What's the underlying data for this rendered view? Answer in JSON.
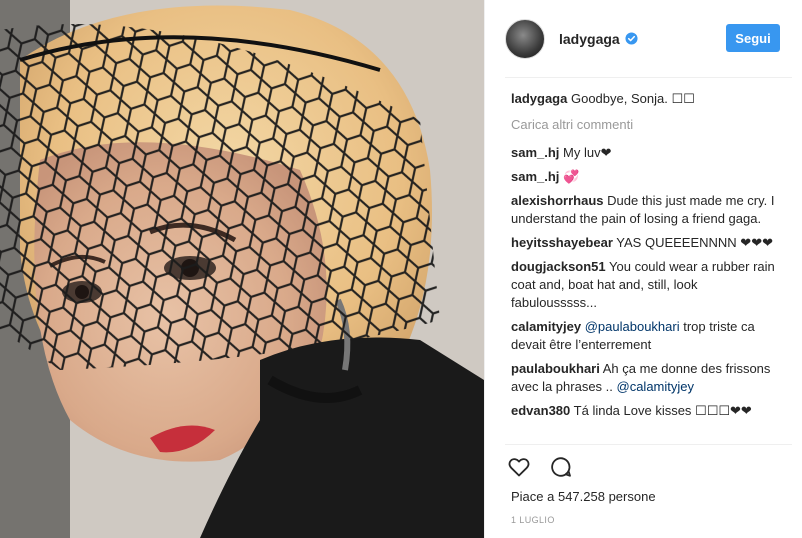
{
  "post": {
    "author": "ladygaga",
    "follow_label": "Segui",
    "caption_user": "ladygaga",
    "caption_text": "Goodbye, Sonja. ☐☐",
    "load_more": "Carica altri commenti",
    "comments": [
      {
        "user": "sam_.hj",
        "text": "My luv❤"
      },
      {
        "user": "sam_.hj",
        "text": "💞"
      },
      {
        "user": "alexishorrhaus",
        "text": "Dude this just made me cry. I understand the pain of losing a friend gaga."
      },
      {
        "user": "heyitsshayebear",
        "text": "YAS QUEEEENNNN ❤❤❤"
      },
      {
        "user": "dougjackson51",
        "text": "You could wear a rubber rain coat and, boat hat and, still, look fabulousssss..."
      },
      {
        "user": "calamityjey",
        "mention": "@paulaboukhari",
        "text": " trop triste ca devait être l’enterrement"
      },
      {
        "user": "paulaboukhari",
        "text": "Ah ça me donne des frissons avec la phrases .. ",
        "mention": "@calamityjey"
      },
      {
        "user": "edvan380",
        "text": "Tá linda Love kisses ☐☐☐❤❤"
      }
    ],
    "likes": "Piace a 547.258 persone",
    "date": "1 LUGLIO"
  },
  "icons": {
    "verified": "verified-badge-icon",
    "like": "heart-icon",
    "comment": "comment-icon"
  },
  "colors": {
    "accent": "#3897f0",
    "mention": "#003569",
    "muted": "#999999"
  }
}
